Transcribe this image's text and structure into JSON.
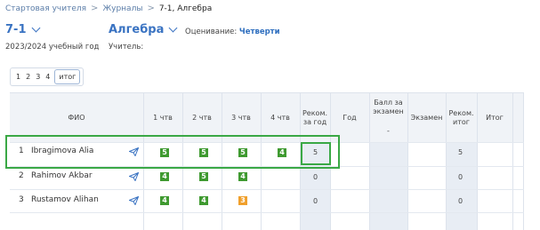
{
  "breadcrumb": {
    "items": [
      "Стартовая учителя",
      "Журналы",
      "7-1, Алгебра"
    ],
    "separator": ">"
  },
  "header": {
    "class_label": "7-1",
    "year_label": "2023/2024 учебный год",
    "subject_label": "Алгебра",
    "teacher_label": "Учитель:",
    "grading_label": "Оценивание:",
    "grading_value": "Четверти"
  },
  "tabs": [
    "1",
    "2",
    "3",
    "4",
    "итог"
  ],
  "table": {
    "columns": {
      "fio": "ФИО",
      "q1": "1 чтв",
      "q2": "2 чтв",
      "q3": "3 чтв",
      "q4": "4 чтв",
      "rec_quarter": "Реком. за год",
      "year": "Год",
      "exam_score": "Балл за экзамен",
      "exam_dash": "-",
      "exam": "Экзамен",
      "rec_final": "Реком. итог",
      "final": "Итог"
    },
    "rows": [
      {
        "num": "1",
        "name": "Ibragimova Alia",
        "q1": "5",
        "q2": "5",
        "q3": "5",
        "q4": "4",
        "rec": "5",
        "rec_final": "5"
      },
      {
        "num": "2",
        "name": "Rahimov Akbar",
        "q1": "4",
        "q2": "5",
        "q3": "4",
        "q4": "",
        "rec": "0",
        "rec_final": "0"
      },
      {
        "num": "3",
        "name": "Rustamov Alihan",
        "q1": "4",
        "q2": "4",
        "q3": "3",
        "q4": "",
        "rec": "0",
        "rec_final": "0"
      }
    ]
  },
  "colors": {
    "accent": "#3a73c2",
    "grade_good": "#3f9a30",
    "grade_mid": "#f0a02c",
    "highlight": "#3aa845"
  }
}
